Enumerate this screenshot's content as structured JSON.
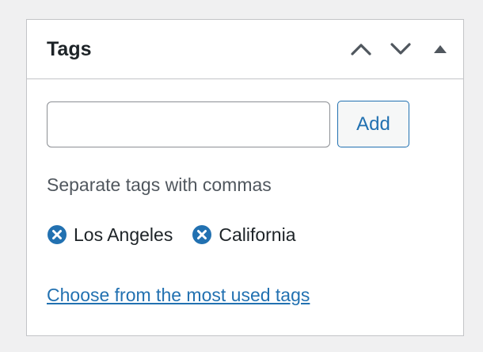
{
  "panel": {
    "title": "Tags",
    "header_buttons": [
      {
        "name": "move-up",
        "icon": "chevron-up-icon"
      },
      {
        "name": "move-down",
        "icon": "chevron-down-icon"
      },
      {
        "name": "toggle-panel",
        "icon": "triangle-up-icon"
      }
    ]
  },
  "add_tag": {
    "input_value": "",
    "input_placeholder": "",
    "button_label": "Add"
  },
  "help_text": "Separate tags with commas",
  "tags": [
    {
      "label": "Los Angeles",
      "remove_icon": "remove-circle-icon"
    },
    {
      "label": "California",
      "remove_icon": "remove-circle-icon"
    }
  ],
  "most_used_link": "Choose from the most used tags",
  "colors": {
    "accent": "#2271b1",
    "text": "#1d2327",
    "muted_text": "#50575e",
    "border": "#c3c4c7",
    "icon_gray": "#50575e"
  }
}
